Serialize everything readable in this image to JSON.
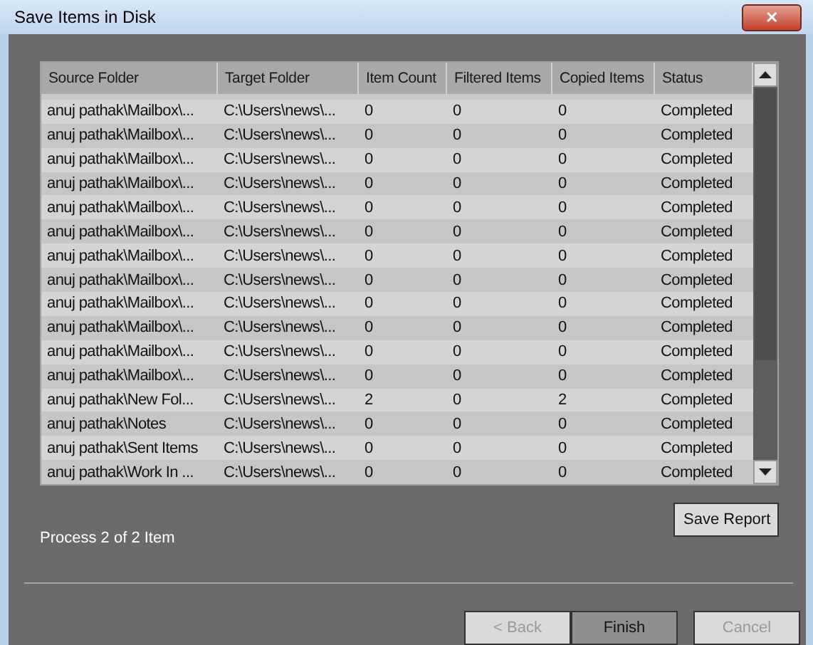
{
  "window": {
    "title": "Save Items in Disk",
    "close": "✕"
  },
  "table": {
    "columns": [
      "Source Folder",
      "Target Folder",
      "Item Count",
      "Filtered Items",
      "Copied Items",
      "Status"
    ],
    "rows": [
      [
        "anuj pathak\\Mailbox\\...",
        "C:\\Users\\news\\...",
        "0",
        "0",
        "0",
        "Completed"
      ],
      [
        "anuj pathak\\Mailbox\\...",
        "C:\\Users\\news\\...",
        "0",
        "0",
        "0",
        "Completed"
      ],
      [
        "anuj pathak\\Mailbox\\...",
        "C:\\Users\\news\\...",
        "0",
        "0",
        "0",
        "Completed"
      ],
      [
        "anuj pathak\\Mailbox\\...",
        "C:\\Users\\news\\...",
        "0",
        "0",
        "0",
        "Completed"
      ],
      [
        "anuj pathak\\Mailbox\\...",
        "C:\\Users\\news\\...",
        "0",
        "0",
        "0",
        "Completed"
      ],
      [
        "anuj pathak\\Mailbox\\...",
        "C:\\Users\\news\\...",
        "0",
        "0",
        "0",
        "Completed"
      ],
      [
        "anuj pathak\\Mailbox\\...",
        "C:\\Users\\news\\...",
        "0",
        "0",
        "0",
        "Completed"
      ],
      [
        "anuj pathak\\Mailbox\\...",
        "C:\\Users\\news\\...",
        "0",
        "0",
        "0",
        "Completed"
      ],
      [
        "anuj pathak\\Mailbox\\...",
        "C:\\Users\\news\\...",
        "0",
        "0",
        "0",
        "Completed"
      ],
      [
        "anuj pathak\\Mailbox\\...",
        "C:\\Users\\news\\...",
        "0",
        "0",
        "0",
        "Completed"
      ],
      [
        "anuj pathak\\Mailbox\\...",
        "C:\\Users\\news\\...",
        "0",
        "0",
        "0",
        "Completed"
      ],
      [
        "anuj pathak\\Mailbox\\...",
        "C:\\Users\\news\\...",
        "0",
        "0",
        "0",
        "Completed"
      ],
      [
        "anuj pathak\\New Fol...",
        "C:\\Users\\news\\...",
        "2",
        "0",
        "2",
        "Completed"
      ],
      [
        "anuj pathak\\Notes",
        "C:\\Users\\news\\...",
        "0",
        "0",
        "0",
        "Completed"
      ],
      [
        "anuj pathak\\Sent Items",
        "C:\\Users\\news\\...",
        "0",
        "0",
        "0",
        "Completed"
      ],
      [
        "anuj pathak\\Work In ...",
        "C:\\Users\\news\\...",
        "0",
        "0",
        "0",
        "Completed"
      ]
    ]
  },
  "progress_text": "Process 2 of 2 Item",
  "save_report": "Save Report",
  "buttons": [
    {
      "label": "< Back",
      "disabled": true,
      "selected": false
    },
    {
      "label": "Finish",
      "disabled": false,
      "selected": true
    },
    {
      "label": "Cancel",
      "disabled": true,
      "selected": false
    }
  ]
}
